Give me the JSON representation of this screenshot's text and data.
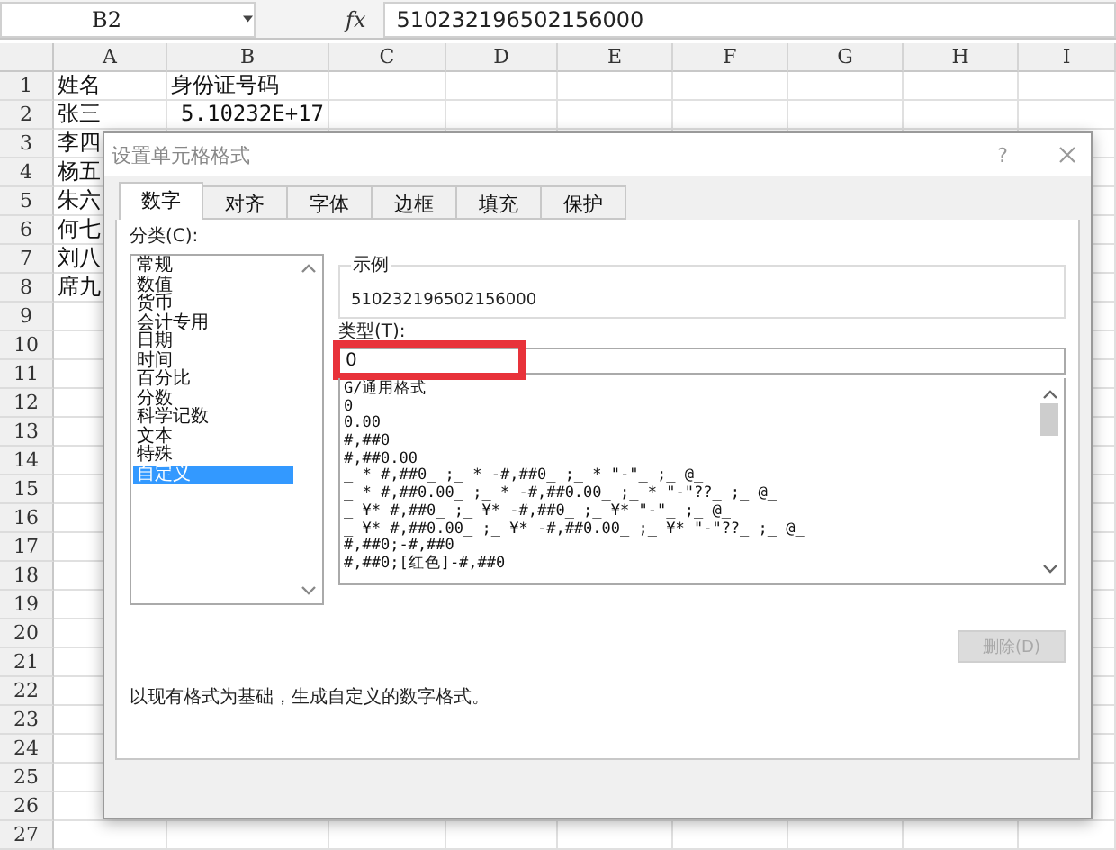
{
  "formula_bar": {
    "name_box": "B2",
    "function_label": "fx",
    "value": "510232196502156000"
  },
  "sheet": {
    "columns": [
      "A",
      "B",
      "C",
      "D",
      "E",
      "F",
      "G",
      "H",
      "I"
    ],
    "rows": [
      {
        "number": "1",
        "cells": [
          "姓名",
          "身份证号码"
        ]
      },
      {
        "number": "2",
        "cells": [
          "张三",
          "5.10232E+17"
        ]
      },
      {
        "number": "3",
        "cells": [
          "李四"
        ]
      },
      {
        "number": "4",
        "cells": [
          "杨五"
        ]
      },
      {
        "number": "5",
        "cells": [
          "朱六"
        ]
      },
      {
        "number": "6",
        "cells": [
          "何七"
        ]
      },
      {
        "number": "7",
        "cells": [
          "刘八"
        ]
      },
      {
        "number": "8",
        "cells": [
          "席九"
        ]
      },
      {
        "number": "9"
      },
      {
        "number": "10"
      },
      {
        "number": "11"
      },
      {
        "number": "12"
      },
      {
        "number": "13"
      },
      {
        "number": "14"
      },
      {
        "number": "15"
      },
      {
        "number": "16"
      },
      {
        "number": "17"
      },
      {
        "number": "18"
      },
      {
        "number": "19"
      },
      {
        "number": "20"
      },
      {
        "number": "21"
      },
      {
        "number": "22"
      },
      {
        "number": "23"
      },
      {
        "number": "24"
      },
      {
        "number": "25"
      },
      {
        "number": "26"
      },
      {
        "number": "27"
      }
    ]
  },
  "dialog": {
    "title": "设置单元格格式",
    "help": "?",
    "tabs": [
      {
        "label": "数字",
        "selected": true
      },
      {
        "label": "对齐",
        "selected": false
      },
      {
        "label": "字体",
        "selected": false
      },
      {
        "label": "边框",
        "selected": false
      },
      {
        "label": "填充",
        "selected": false
      },
      {
        "label": "保护",
        "selected": false
      }
    ],
    "category_label": "分类(C):",
    "categories": [
      {
        "label": "常规",
        "selected": false
      },
      {
        "label": "数值",
        "selected": false
      },
      {
        "label": "货币",
        "selected": false
      },
      {
        "label": "会计专用",
        "selected": false
      },
      {
        "label": "日期",
        "selected": false
      },
      {
        "label": "时间",
        "selected": false
      },
      {
        "label": "百分比",
        "selected": false
      },
      {
        "label": "分数",
        "selected": false
      },
      {
        "label": "科学记数",
        "selected": false
      },
      {
        "label": "文本",
        "selected": false
      },
      {
        "label": "特殊",
        "selected": false
      },
      {
        "label": "自定义",
        "selected": true
      }
    ],
    "sample": {
      "label": "示例",
      "value": "510232196502156000"
    },
    "type_label": "类型(T):",
    "type_value": "0",
    "formats": [
      "G/通用格式",
      "0",
      "0.00",
      "#,##0",
      "#,##0.00",
      "_ * #,##0_ ;_ * -#,##0_ ;_ * \"-\"_ ;_ @_",
      "_ * #,##0.00_ ;_ * -#,##0.00_ ;_ * \"-\"??_ ;_ @_",
      "_ ¥* #,##0_ ;_ ¥* -#,##0_ ;_ ¥* \"-\"_ ;_ @_",
      "_ ¥* #,##0.00_ ;_ ¥* -#,##0.00_ ;_ ¥* \"-\"??_ ;_ @_",
      "#,##0;-#,##0",
      "#,##0;[红色]-#,##0"
    ],
    "delete_button": {
      "label": "删除(D)",
      "disabled": true
    },
    "description": "以现有格式为基础，生成自定义的数字格式。"
  }
}
